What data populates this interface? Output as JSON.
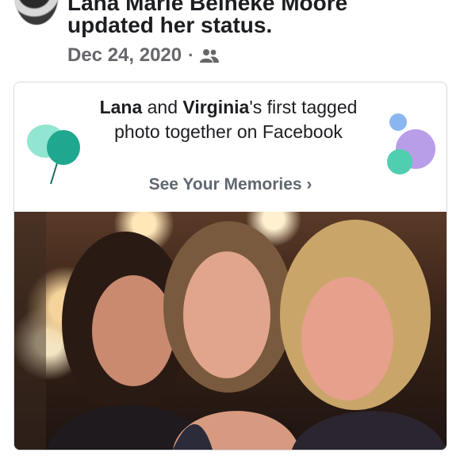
{
  "post": {
    "author": "Lana Marie Beineke Moore",
    "status": "updated her status.",
    "date": "Dec 24, 2020",
    "separator": "·",
    "audience_icon": "friends-icon"
  },
  "memory_card": {
    "name_a": "Lana",
    "connector": " and ",
    "name_b": "Virginia",
    "headline_rest": "'s first tagged photo together on Facebook",
    "cta_label": "See Your Memories",
    "cta_chevron": "›"
  },
  "colors": {
    "primary_text": "#1c1e21",
    "secondary_text": "#65676b",
    "card_border": "#d7d9dd",
    "balloon_teal": "#3cc4a8",
    "bubble_purple": "#b89ee8",
    "bubble_blue": "#8ab6f0"
  }
}
